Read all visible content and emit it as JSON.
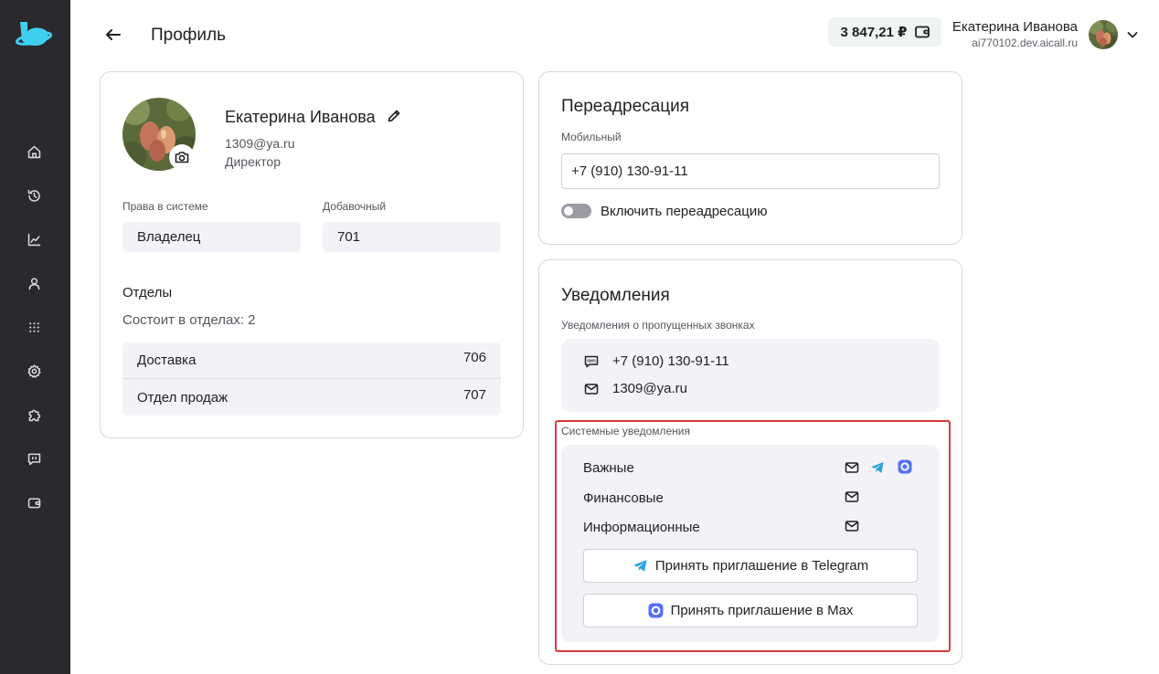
{
  "header": {
    "title": "Профиль",
    "balance": "3 847,21 ₽",
    "user_name": "Екатерина Иванова",
    "user_domain": "ai770102.dev.aicall.ru"
  },
  "sidebar": {
    "items": [
      {
        "icon": "home-icon"
      },
      {
        "icon": "history-icon"
      },
      {
        "icon": "analytics-icon"
      },
      {
        "icon": "user-icon"
      },
      {
        "icon": "dialpad-icon"
      },
      {
        "icon": "gear-icon"
      },
      {
        "icon": "puzzle-icon"
      },
      {
        "icon": "chat-icon"
      },
      {
        "icon": "wallet-icon"
      }
    ]
  },
  "profile": {
    "name": "Екатерина Иванова",
    "email": "1309@ya.ru",
    "role": "Директор",
    "rights_label": "Права в системе",
    "rights_value": "Владелец",
    "extension_label": "Добавочный",
    "extension_value": "701",
    "departments_title": "Отделы",
    "departments_count": "Состоит в отделах: 2",
    "departments": [
      {
        "name": "Доставка",
        "ext": "706"
      },
      {
        "name": "Отдел продаж",
        "ext": "707"
      }
    ]
  },
  "forwarding": {
    "title": "Переадресация",
    "mobile_label": "Мобильный",
    "mobile_value": "+7 (910) 130-91-11",
    "toggle_label": "Включить переадресацию",
    "toggle_on": false
  },
  "notifications": {
    "title": "Уведомления",
    "missed_label": "Уведомления о пропущенных звонках",
    "missed_phone": "+7 (910) 130-91-11",
    "missed_email": "1309@ya.ru",
    "system_label": "Системные уведомления",
    "system_rows": [
      {
        "label": "Важные",
        "channels": [
          "email",
          "telegram",
          "max"
        ]
      },
      {
        "label": "Финансовые",
        "channels": [
          "email"
        ]
      },
      {
        "label": "Информационные",
        "channels": [
          "email"
        ]
      }
    ],
    "telegram_button": "Принять приглашение в Telegram",
    "max_button": "Принять приглашение в Max"
  },
  "colors": {
    "sidebar_bg": "#2a2a2e",
    "logo": "#3fd0f0",
    "telegram": "#2aa3e0",
    "highlight": "#d93a3a",
    "balance_bg": "#edf4f2"
  }
}
